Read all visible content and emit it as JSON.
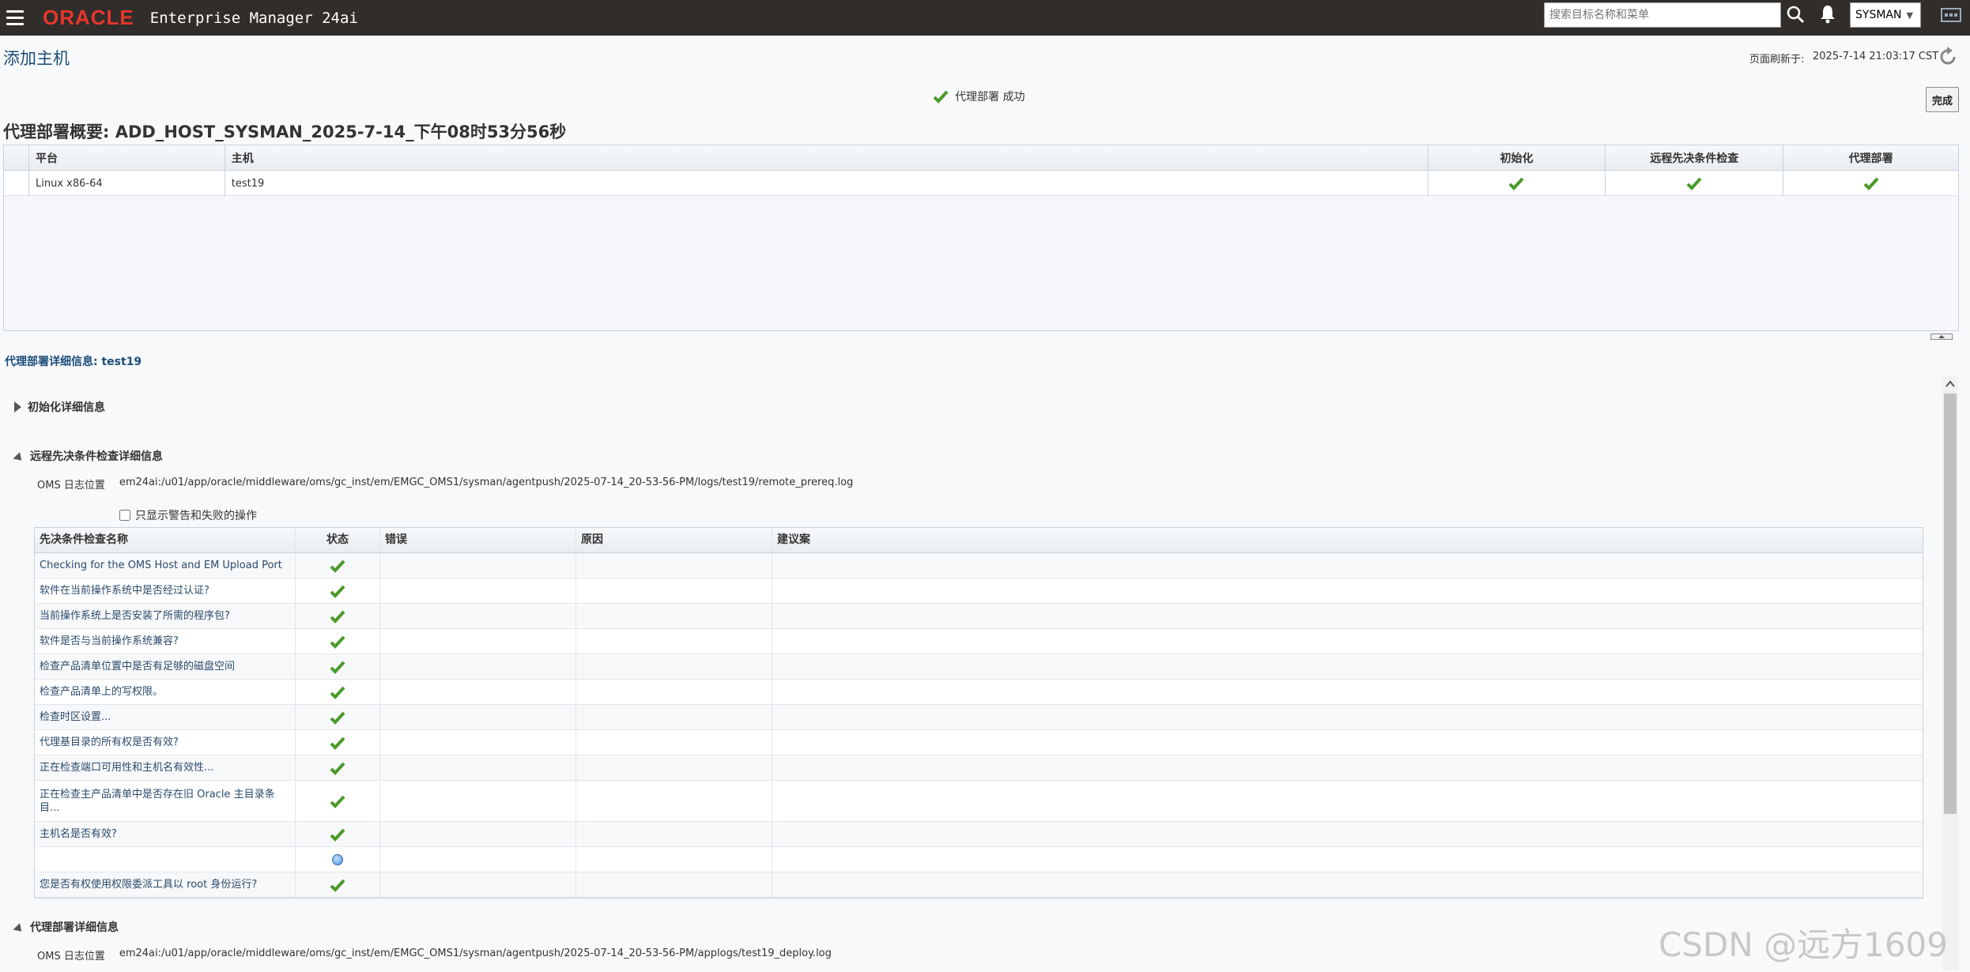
{
  "topbar": {
    "logo": "ORACLE",
    "product": "Enterprise Manager 24ai",
    "search_placeholder": "搜索目标名称和菜单",
    "user": "SYSMAN"
  },
  "header": {
    "title": "添加主机",
    "refresh_label": "页面刷新于:",
    "refresh_time": "2025-7-14 21:03:17 CST"
  },
  "status": {
    "text": "代理部署 成功",
    "done_label": "完成"
  },
  "summary": {
    "title": "代理部署概要: ADD_HOST_SYSMAN_2025-7-14_下午08时53分56秒",
    "columns": [
      "平台",
      "主机",
      "初始化",
      "远程先决条件检查",
      "代理部署"
    ],
    "rows": [
      {
        "platform": "Linux x86-64",
        "host": "test19",
        "init": "success",
        "prereq": "success",
        "deploy": "success"
      }
    ]
  },
  "detail": {
    "title": "代理部署详细信息: test19",
    "init_section": "初始化详细信息",
    "prereq_section": "远程先决条件检查详细信息",
    "oms_label": "OMS 日志位置",
    "prereq_log": "em24ai:/u01/app/oracle/middleware/oms/gc_inst/em/EMGC_OMS1/sysman/agentpush/2025-07-14_20-53-56-PM/logs/test19/remote_prereq.log",
    "filter_label": "只显示警告和失败的操作",
    "deploy_section": "代理部署详细信息",
    "deploy_log": "em24ai:/u01/app/oracle/middleware/oms/gc_inst/em/EMGC_OMS1/sysman/agentpush/2025-07-14_20-53-56-PM/applogs/test19_deploy.log"
  },
  "prereq_table": {
    "columns": [
      "先决条件检查名称",
      "状态",
      "错误",
      "原因",
      "建议案"
    ],
    "rows": [
      {
        "name": "Checking for the OMS Host and EM Upload Port",
        "status": "success"
      },
      {
        "name": "软件在当前操作系统中是否经过认证?",
        "status": "success"
      },
      {
        "name": "当前操作系统上是否安装了所需的程序包?",
        "status": "success"
      },
      {
        "name": "软件是否与当前操作系统兼容?",
        "status": "success"
      },
      {
        "name": "检查产品清单位置中是否有足够的磁盘空间",
        "status": "success"
      },
      {
        "name": "检查产品清单上的写权限。",
        "status": "success"
      },
      {
        "name": "检查时区设置...",
        "status": "success"
      },
      {
        "name": "代理基目录的所有权是否有效?",
        "status": "success"
      },
      {
        "name": "正在检查端口可用性和主机名有效性...",
        "status": "success"
      },
      {
        "name": "正在检查主产品清单中是否存在旧 Oracle 主目录条目...",
        "status": "success"
      },
      {
        "name": "主机名是否有效?",
        "status": "success"
      },
      {
        "name": "",
        "status": "info"
      },
      {
        "name": "您是否有权使用权限委派工具以 root 身份运行?",
        "status": "success"
      }
    ]
  },
  "watermark": "CSDN @远方1609",
  "colors": {
    "topbar": "#312d2a",
    "oracle_red": "#e8362d",
    "success_green": "#4a9a2a",
    "title_blue": "#1a4d7a"
  }
}
